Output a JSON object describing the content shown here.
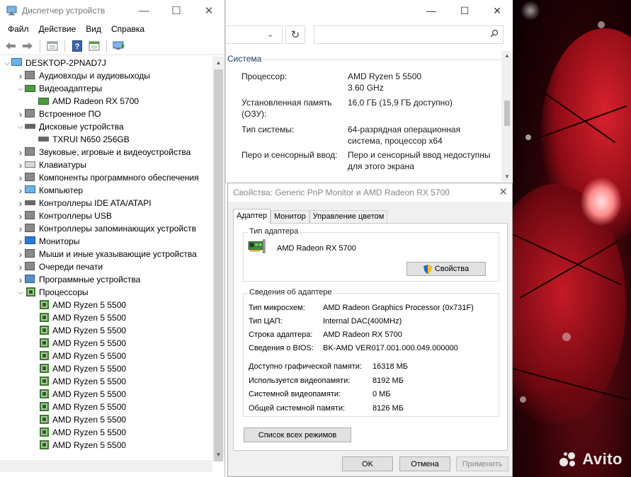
{
  "device_manager": {
    "title": "Диспетчер устройств",
    "menu": [
      "Файл",
      "Действие",
      "Вид",
      "Справка"
    ],
    "tree": [
      {
        "label": "DESKTOP-2PNAD7J",
        "level": 0,
        "expander": "expanded",
        "icon": "computer-icon"
      },
      {
        "label": "Аудиовходы и аудиовыходы",
        "level": 1,
        "expander": "collapsed",
        "icon": "speaker-icon"
      },
      {
        "label": "Видеоадаптеры",
        "level": 1,
        "expander": "expanded",
        "icon": "display-adapter-icon"
      },
      {
        "label": "AMD Radeon RX 5700",
        "level": 2,
        "expander": "none",
        "icon": "display-adapter-icon"
      },
      {
        "label": "Встроенное ПО",
        "level": 1,
        "expander": "collapsed",
        "icon": "firmware-icon"
      },
      {
        "label": "Дисковые устройства",
        "level": 1,
        "expander": "expanded",
        "icon": "disk-drive-icon"
      },
      {
        "label": "TXRUI N650 256GB",
        "level": 2,
        "expander": "none",
        "icon": "disk-drive-icon"
      },
      {
        "label": "Звуковые, игровые и видеоустройства",
        "level": 1,
        "expander": "collapsed",
        "icon": "speaker-icon"
      },
      {
        "label": "Клавиатуры",
        "level": 1,
        "expander": "collapsed",
        "icon": "keyboard-icon"
      },
      {
        "label": "Компоненты программного обеспечения",
        "level": 1,
        "expander": "collapsed",
        "icon": "software-component-icon"
      },
      {
        "label": "Компьютер",
        "level": 1,
        "expander": "collapsed",
        "icon": "computer-icon"
      },
      {
        "label": "Контроллеры IDE ATA/ATAPI",
        "level": 1,
        "expander": "collapsed",
        "icon": "ide-controller-icon"
      },
      {
        "label": "Контроллеры USB",
        "level": 1,
        "expander": "collapsed",
        "icon": "usb-icon"
      },
      {
        "label": "Контроллеры запоминающих устройств",
        "level": 1,
        "expander": "collapsed",
        "icon": "storage-controller-icon"
      },
      {
        "label": "Мониторы",
        "level": 1,
        "expander": "collapsed",
        "icon": "monitor-icon"
      },
      {
        "label": "Мыши и иные указывающие устройства",
        "level": 1,
        "expander": "collapsed",
        "icon": "mouse-icon"
      },
      {
        "label": "Очереди печати",
        "level": 1,
        "expander": "collapsed",
        "icon": "printer-icon"
      },
      {
        "label": "Программные устройства",
        "level": 1,
        "expander": "collapsed",
        "icon": "software-device-icon"
      },
      {
        "label": "Процессоры",
        "level": 1,
        "expander": "expanded",
        "icon": "processor-icon"
      },
      {
        "label": "AMD Ryzen 5 5500",
        "level": 2,
        "expander": "none",
        "icon": "processor-icon"
      },
      {
        "label": "AMD Ryzen 5 5500",
        "level": 2,
        "expander": "none",
        "icon": "processor-icon"
      },
      {
        "label": "AMD Ryzen 5 5500",
        "level": 2,
        "expander": "none",
        "icon": "processor-icon"
      },
      {
        "label": "AMD Ryzen 5 5500",
        "level": 2,
        "expander": "none",
        "icon": "processor-icon"
      },
      {
        "label": "AMD Ryzen 5 5500",
        "level": 2,
        "expander": "none",
        "icon": "processor-icon"
      },
      {
        "label": "AMD Ryzen 5 5500",
        "level": 2,
        "expander": "none",
        "icon": "processor-icon"
      },
      {
        "label": "AMD Ryzen 5 5500",
        "level": 2,
        "expander": "none",
        "icon": "processor-icon"
      },
      {
        "label": "AMD Ryzen 5 5500",
        "level": 2,
        "expander": "none",
        "icon": "processor-icon"
      },
      {
        "label": "AMD Ryzen 5 5500",
        "level": 2,
        "expander": "none",
        "icon": "processor-icon"
      },
      {
        "label": "AMD Ryzen 5 5500",
        "level": 2,
        "expander": "none",
        "icon": "processor-icon"
      },
      {
        "label": "AMD Ryzen 5 5500",
        "level": 2,
        "expander": "none",
        "icon": "processor-icon"
      },
      {
        "label": "AMD Ryzen 5 5500",
        "level": 2,
        "expander": "none",
        "icon": "processor-icon"
      }
    ]
  },
  "system_window": {
    "section": "Система",
    "rows": [
      {
        "label": "Процессор:",
        "value": "AMD Ryzen 5 5500\n3.60 GHz"
      },
      {
        "label": "Установленная память\n(ОЗУ):",
        "value": "16,0 ГБ (15,9 ГБ доступно)"
      },
      {
        "label": "Тип системы:",
        "value": "64-разрядная операционная\nсистема, процессор x64"
      },
      {
        "label": "Перо и сенсорный ввод:",
        "value": "Перо и сенсорный ввод недоступны\nдля этого экрана"
      }
    ]
  },
  "properties_dialog": {
    "title": "Свойства: Generic PnP Monitor и AMD Radeon RX 5700",
    "tabs": [
      "Адаптер",
      "Монитор",
      "Управление цветом"
    ],
    "active_tab": "Адаптер",
    "adapter_type_group": "Тип адаптера",
    "adapter_name": "AMD Radeon RX 5700",
    "properties_button": "Свойства",
    "adapter_info_group": "Сведения об адаптере",
    "info": [
      {
        "label": "Тип микросхем:",
        "value": "AMD Radeon Graphics Processor (0x731F)"
      },
      {
        "label": "Тип ЦАП:",
        "value": "Internal DAC(400MHz)"
      },
      {
        "label": "Строка адаптера:",
        "value": "AMD Radeon RX 5700"
      },
      {
        "label": "Сведения о BIOS:",
        "value": "BK-AMD VER017.001.000.049.000000"
      }
    ],
    "memory": [
      {
        "label": "Доступно графической памяти:",
        "value": "16318 МБ"
      },
      {
        "label": "Используется видеопамяти:",
        "value": "8192 МБ"
      },
      {
        "label": "Системной видеопамяти:",
        "value": "0 МБ"
      },
      {
        "label": "Общей системной памяти:",
        "value": "8126 МБ"
      }
    ],
    "list_modes_button": "Список всех режимов",
    "ok_button": "OK",
    "cancel_button": "Отмена",
    "apply_button": "Применить"
  },
  "watermark": "Avito"
}
